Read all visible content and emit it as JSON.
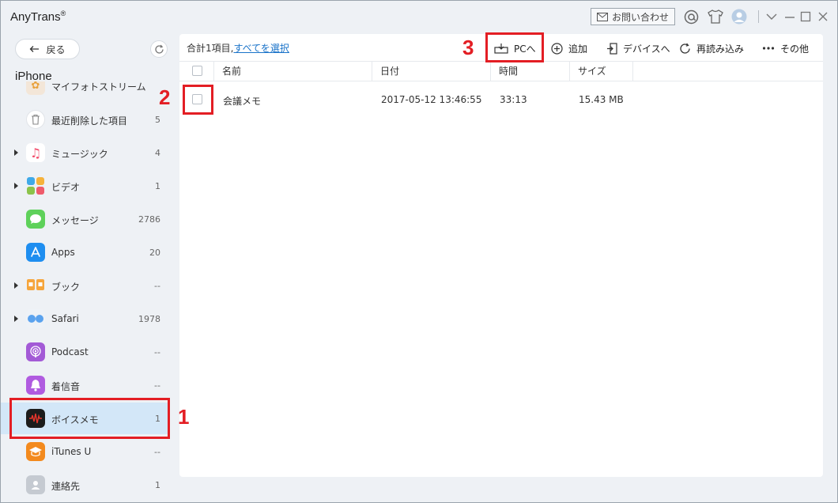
{
  "app": {
    "title": "AnyTrans",
    "reg_mark": "®"
  },
  "titlebar": {
    "contact_label": "お問い合わせ"
  },
  "sidebar": {
    "back_label": "戻る",
    "device_name": "iPhone",
    "partial_top_label": "マイフォトストリーム",
    "items": [
      {
        "label": "最近削除した項目",
        "count": "5"
      },
      {
        "label": "ミュージック",
        "count": "4"
      },
      {
        "label": "ビデオ",
        "count": "1"
      },
      {
        "label": "メッセージ",
        "count": "2786"
      },
      {
        "label": "Apps",
        "count": "20"
      },
      {
        "label": "ブック",
        "count": "--"
      },
      {
        "label": "Safari",
        "count": "1978"
      },
      {
        "label": "Podcast",
        "count": "--"
      },
      {
        "label": "着信音",
        "count": "--"
      },
      {
        "label": "ボイスメモ",
        "count": "1"
      },
      {
        "label": "iTunes U",
        "count": "--"
      },
      {
        "label": "連絡先",
        "count": "1"
      }
    ]
  },
  "main": {
    "summary_prefix": "合計1項目,",
    "select_all_label": "すべてを選択",
    "toolbar": {
      "to_pc": "PCへ",
      "add": "追加",
      "to_device": "デバイスへ",
      "reload": "再読み込み",
      "more": "その他"
    },
    "columns": [
      "名前",
      "日付",
      "時間",
      "サイズ"
    ],
    "rows": [
      {
        "name": "会議メモ",
        "date": "2017-05-12 13:46:55",
        "duration": "33:13",
        "size": "15.43 MB"
      }
    ]
  },
  "annotations": {
    "step1": "1",
    "step2": "2",
    "step3": "3",
    "color": "#e31e24"
  },
  "colors": {
    "selected_bg": "#d3e7f8",
    "link": "#1a73c9",
    "app_bg": "#eef1f5"
  }
}
